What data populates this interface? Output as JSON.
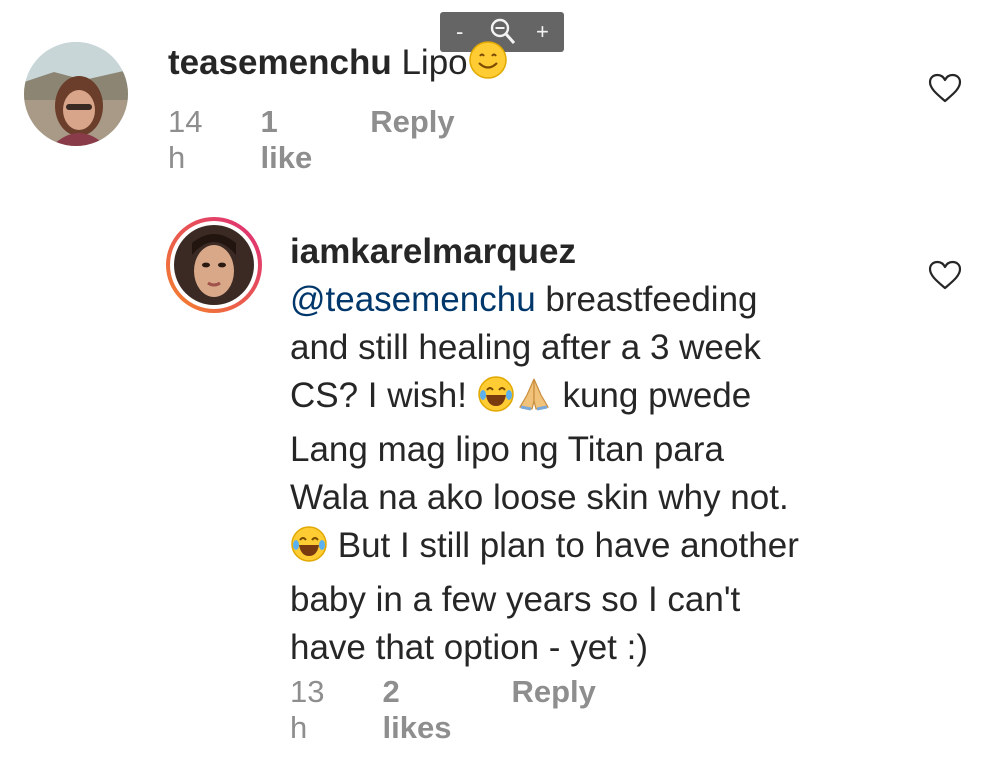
{
  "colors": {
    "text": "#262626",
    "muted": "#8e8e8e",
    "mention": "#00376b",
    "story_ring_start": "#f58529",
    "story_ring_end": "#dd2a7b"
  },
  "zoom_toolbar": {
    "minus": "-",
    "zoom_icon": "magnifier-icon",
    "plus": "+"
  },
  "comments": [
    {
      "username": "teasemenchu",
      "text": "Lipo",
      "emoji": "smiling-face-emoji",
      "time": "14 h",
      "likes": "1 like",
      "reply": "Reply",
      "like_icon": "heart-icon"
    },
    {
      "username": "iamkarelmarquez",
      "mention": "@teasemenchu",
      "line1_rest": " breastfeeding",
      "line2": "and still healing after a 3 week",
      "line3_a": "CS? I wish!",
      "line3_b": "kung pwede",
      "line4": "Lang mag lipo ng Titan para",
      "line5": "Wala na ako loose skin why not.",
      "line6_rest": "But I still plan to have another",
      "line7": "baby in a few years so I can't",
      "line8": "have that option - yet :)",
      "emojis": [
        "laughing-tears-emoji",
        "praying-hands-emoji"
      ],
      "time": "13 h",
      "likes": "2 likes",
      "reply": "Reply",
      "like_icon": "heart-icon"
    }
  ]
}
